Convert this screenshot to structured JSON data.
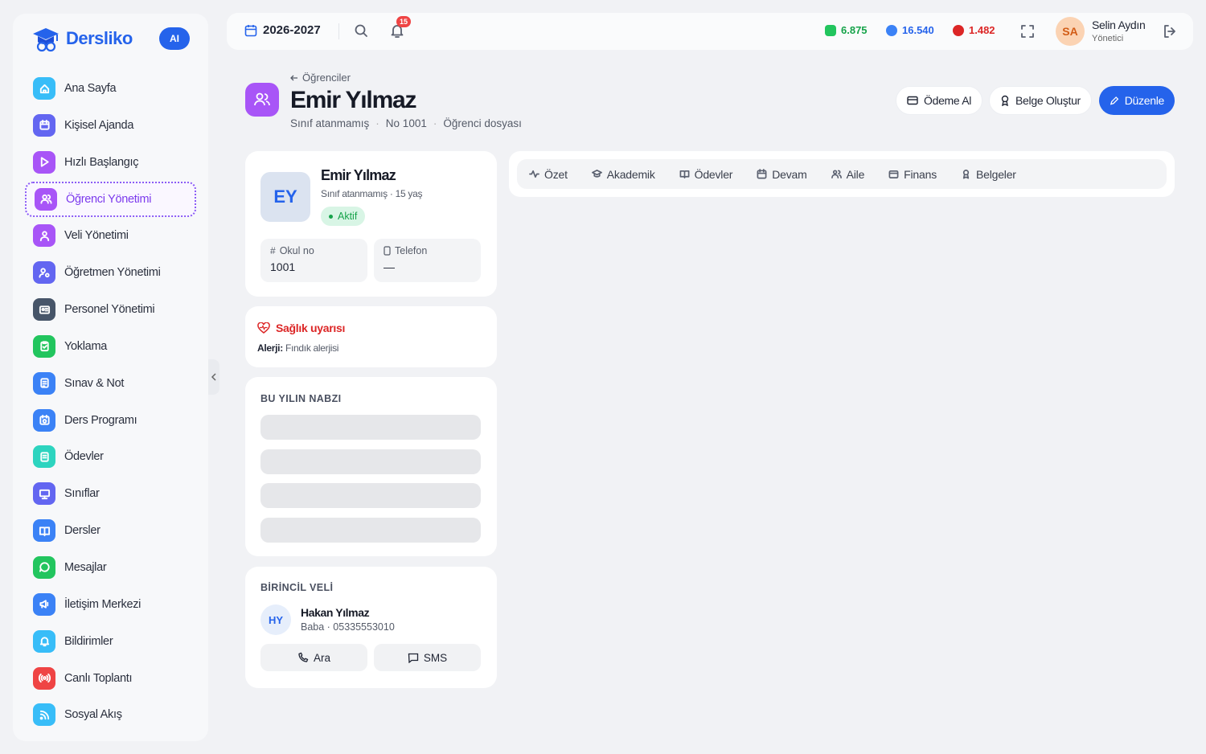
{
  "brand": {
    "name": "Dersliko",
    "ai_badge": "AI"
  },
  "sidebar": {
    "items": [
      {
        "label": "Ana Sayfa",
        "color": "#38bdf8",
        "icon": "home-icon"
      },
      {
        "label": "Kişisel Ajanda",
        "color": "#6366f1",
        "icon": "calendar-icon"
      },
      {
        "label": "Hızlı Başlangıç",
        "color": "#a855f7",
        "icon": "play-icon"
      },
      {
        "label": "Öğrenci Yönetimi",
        "color": "#a855f7",
        "icon": "users-icon",
        "active": true
      },
      {
        "label": "Veli Yönetimi",
        "color": "#a855f7",
        "icon": "parents-icon"
      },
      {
        "label": "Öğretmen Yönetimi",
        "color": "#6366f1",
        "icon": "teacher-icon"
      },
      {
        "label": "Personel Yönetimi",
        "color": "#475569",
        "icon": "id-card-icon"
      },
      {
        "label": "Yoklama",
        "color": "#22c55e",
        "icon": "clipboard-icon"
      },
      {
        "label": "Sınav & Not",
        "color": "#3b82f6",
        "icon": "exam-icon"
      },
      {
        "label": "Ders Programı",
        "color": "#3b82f6",
        "icon": "schedule-icon"
      },
      {
        "label": "Ödevler",
        "color": "#2dd4bf",
        "icon": "homework-icon"
      },
      {
        "label": "Sınıflar",
        "color": "#6366f1",
        "icon": "classroom-icon"
      },
      {
        "label": "Dersler",
        "color": "#3b82f6",
        "icon": "book-icon"
      },
      {
        "label": "Mesajlar",
        "color": "#22c55e",
        "icon": "message-icon"
      },
      {
        "label": "İletişim Merkezi",
        "color": "#3b82f6",
        "icon": "megaphone-icon"
      },
      {
        "label": "Bildirimler",
        "color": "#38bdf8",
        "icon": "bell-icon"
      },
      {
        "label": "Canlı Toplantı",
        "color": "#ef4444",
        "icon": "broadcast-icon"
      },
      {
        "label": "Sosyal Akış",
        "color": "#38bdf8",
        "icon": "feed-icon"
      }
    ]
  },
  "topbar": {
    "year": "2026-2027",
    "notification_count": "15",
    "stats": [
      {
        "value": "6.875",
        "color": "#16a34a"
      },
      {
        "value": "16.540",
        "color": "#2563eb"
      },
      {
        "value": "1.482",
        "color": "#dc2626"
      }
    ],
    "user": {
      "initials": "SA",
      "name": "Selin Aydın",
      "role": "Yönetici"
    }
  },
  "header": {
    "back_label": "Öğrenciler",
    "title": "Emir Yılmaz",
    "sub": [
      "Sınıf atanmamış",
      "No 1001",
      "Öğrenci dosyası"
    ],
    "buttons": {
      "payment": "Ödeme Al",
      "document": "Belge Oluştur",
      "edit": "Düzenle"
    }
  },
  "profile": {
    "initials": "EY",
    "name": "Emir Yılmaz",
    "meta": "Sınıf atanmamış · 15 yaş",
    "status": "Aktif",
    "school_no_label": "Okul no",
    "school_no": "1001",
    "phone_label": "Telefon",
    "phone": "—"
  },
  "health": {
    "title": "Sağlık uyarısı",
    "allergy_label": "Alerji:",
    "allergy_value": "Fındık alerjisi"
  },
  "pulse": {
    "title": "BU YILIN NABZI"
  },
  "parent": {
    "title": "BİRİNCİL VELİ",
    "initials": "HY",
    "name": "Hakan Yılmaz",
    "meta": "Baba · 05335553010",
    "call": "Ara",
    "sms": "SMS"
  },
  "tabs": [
    "Özet",
    "Akademik",
    "Ödevler",
    "Devam",
    "Aile",
    "Finans",
    "Belgeler"
  ]
}
